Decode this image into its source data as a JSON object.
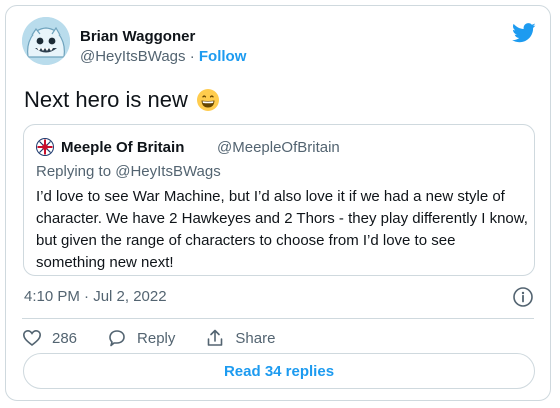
{
  "tweet": {
    "author": {
      "name": "Brian Waggoner",
      "handle": "@HeyItsBWags",
      "separator": "·",
      "follow_label": "Follow"
    },
    "text": "Next hero is new",
    "emoji": "grinning-face-icon",
    "timestamp": "4:10 PM · Jul 2, 2022"
  },
  "quote": {
    "author_name": "Meeple Of Britain",
    "author_handle": "@MeepleOfBritain",
    "replying_to": "Replying to @HeyItsBWags",
    "body": "I’d love to see War Machine, but I’d also love it if we had a new style of character. We have 2 Hawkeyes and 2 Thors - they play differently I know, but given the range of characters to choose from I’d love to see something new next!"
  },
  "actions": {
    "like_count": "286",
    "reply_label": "Reply",
    "share_label": "Share"
  },
  "read_replies_label": "Read 34 replies",
  "colors": {
    "accent": "#1d9bf0",
    "text": "#0f1419",
    "muted": "#536471",
    "border": "#cfd9de"
  },
  "icons": [
    "twitter-bird-icon",
    "info-icon",
    "heart-icon",
    "reply-bubble-icon",
    "share-icon",
    "shield-logo-icon"
  ]
}
